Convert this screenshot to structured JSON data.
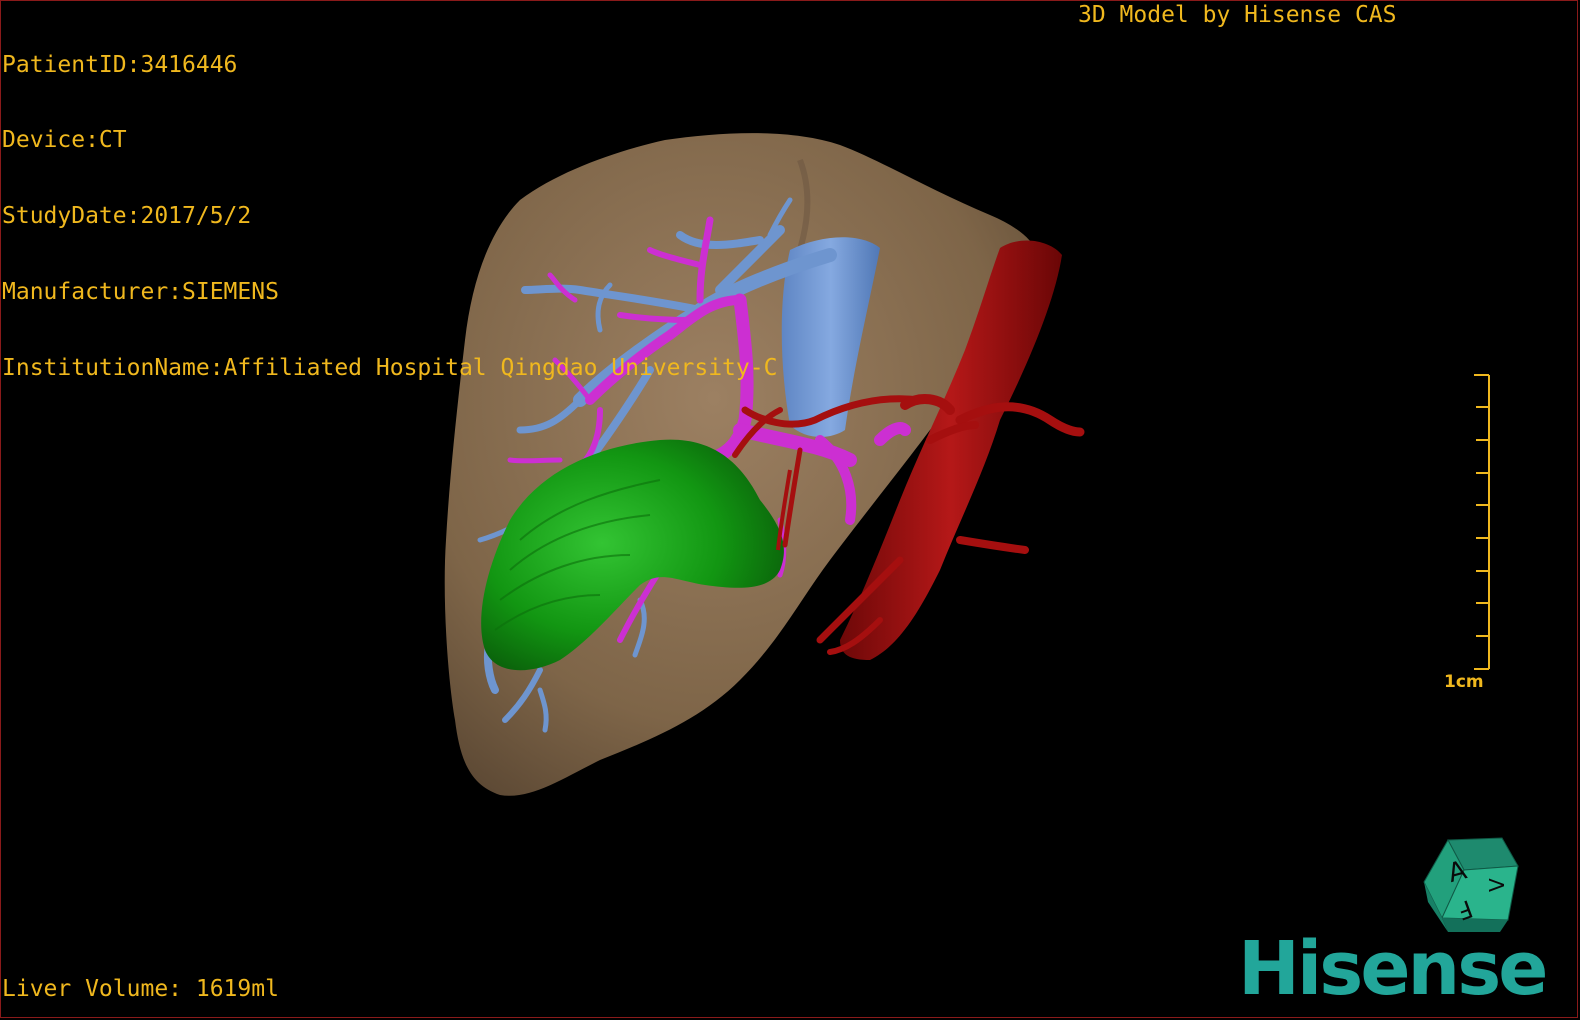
{
  "patient_info": {
    "patient_id": "PatientID:3416446",
    "device": "Device:CT",
    "study_date": "StudyDate:2017/5/2",
    "manufacturer": "Manufacturer:SIEMENS",
    "institution": "InstitutionName:Affiliated Hospital Qingdao University-C"
  },
  "credit": "3D Model by Hisense CAS",
  "liver_volume": "Liver Volume: 1619ml",
  "scale_bar": {
    "label": "1cm",
    "tick_count": 10
  },
  "orientation_cube": {
    "face_top": "A",
    "face_left": "F",
    "face_right": "V"
  },
  "brand_logo": "Hisense",
  "colors": {
    "text": "#f0b81e",
    "liver": "#8b7152",
    "portal_vein": "#6e95cf",
    "bile_duct": "#cc2fd2",
    "artery": "#a50f0f",
    "gallbladder": "#119a11",
    "brand": "#22a69a"
  }
}
